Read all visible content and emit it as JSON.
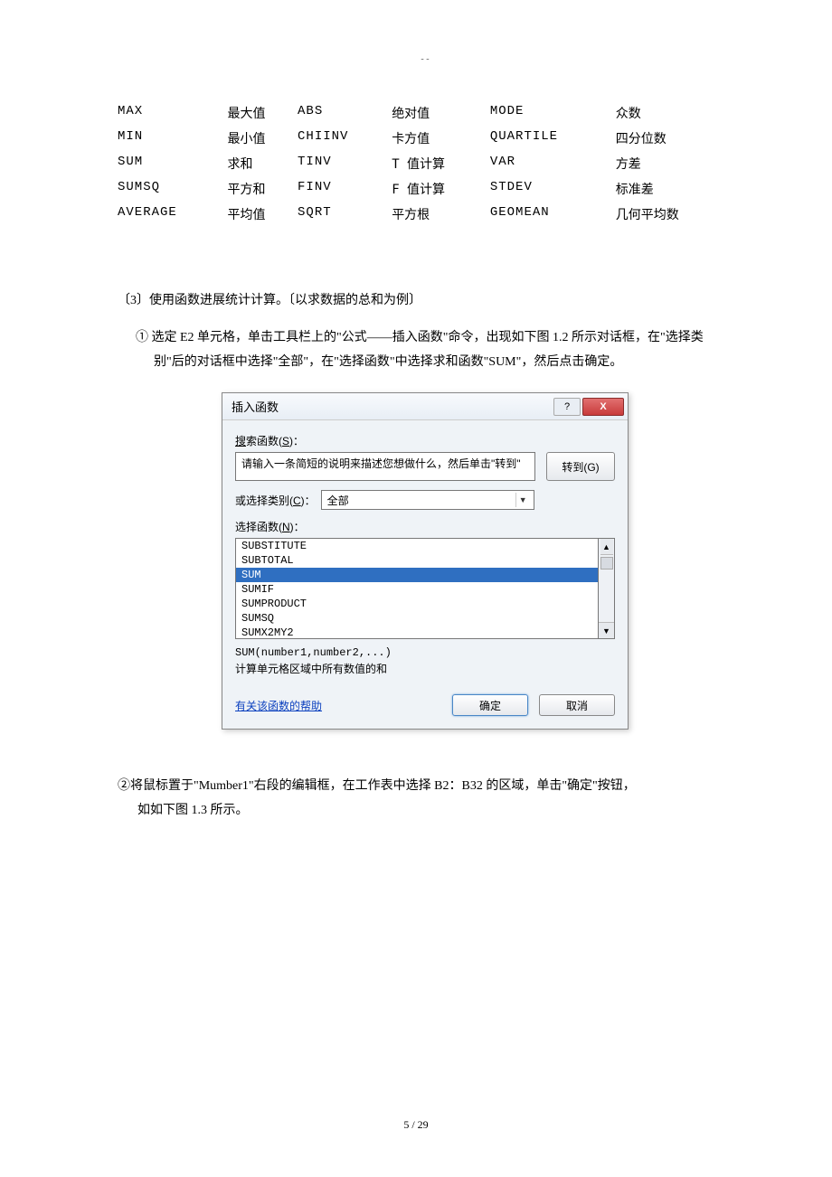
{
  "header_mark": "- -",
  "func_table": {
    "rows": [
      [
        "MAX",
        "最大值",
        "ABS",
        "绝对值",
        "MODE",
        "众数"
      ],
      [
        "MIN",
        "最小值",
        "CHIINV",
        "卡方值",
        "QUARTILE",
        "四分位数"
      ],
      [
        "SUM",
        "求和",
        "TINV",
        "T 值计算",
        "VAR",
        "方差"
      ],
      [
        "SUMSQ",
        "平方和",
        "FINV",
        "F 值计算",
        "STDEV",
        "标准差"
      ],
      [
        "AVERAGE",
        "平均值",
        "SQRT",
        "平方根",
        "GEOMEAN",
        "几何平均数"
      ]
    ]
  },
  "section3_title": "〔3〕使用函数进展统计计算。〔以求数据的总和为例〕",
  "step1": "①  选定 E2 单元格，单击工具栏上的\"公式——插入函数\"命令，出现如下图 1.2 所示对话框，在\"选择类别\"后的对话框中选择\"全部\"，在\"选择函数\"中选择求和函数\"SUM\"，然后点击确定。",
  "dialog": {
    "title": "插入函数",
    "help_icon": "?",
    "close_icon": "X",
    "search_label": "搜索函数(S)：",
    "search_placeholder": "请输入一条简短的说明来描述您想做什么，然后单击\"转到\"",
    "goto_btn": "转到(G)",
    "category_label": "或选择类别(C)：",
    "category_value": "全部",
    "select_label": "选择函数(N)：",
    "list_items": [
      {
        "text": "SUBSTITUTE",
        "selected": false
      },
      {
        "text": "SUBTOTAL",
        "selected": false
      },
      {
        "text": "SUM",
        "selected": true
      },
      {
        "text": "SUMIF",
        "selected": false
      },
      {
        "text": "SUMPRODUCT",
        "selected": false
      },
      {
        "text": "SUMSQ",
        "selected": false
      },
      {
        "text": "SUMX2MY2",
        "selected": false
      }
    ],
    "syntax": "SUM(number1,number2,...)",
    "description": "计算单元格区域中所有数值的和",
    "help_link": "有关该函数的帮助",
    "ok_btn": "确定",
    "cancel_btn": "取消"
  },
  "step2_line1": "②将鼠标置于\"Mumber1\"右段的编辑框，在工作表中选择 B2：B32 的区域，单击\"确定\"按钮，",
  "step2_line2": "如如下图 1.3 所示。",
  "page_number": "5  / 29"
}
